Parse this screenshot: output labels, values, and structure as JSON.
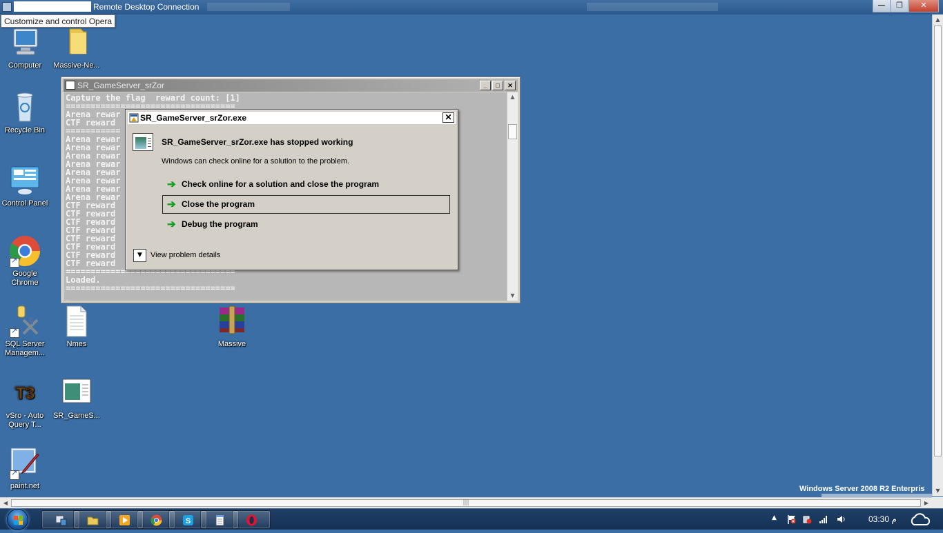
{
  "rdc": {
    "title": "Remote Desktop Connection",
    "tooltip": "Customize and control Opera"
  },
  "desktop": {
    "icons": [
      {
        "label": "Computer"
      },
      {
        "label": "Massive-Ne..."
      },
      {
        "label": "Recycle Bin"
      },
      {
        "label": "Control Panel"
      },
      {
        "label": "Google Chrome"
      },
      {
        "label": "SQL Server Managem..."
      },
      {
        "label": "Nmes"
      },
      {
        "label": "Massive"
      },
      {
        "label": "vSro - Auto Query T..."
      },
      {
        "label": "SR_GameS..."
      },
      {
        "label": "paint.net"
      }
    ],
    "watermark": "Windows Server 2008 R2 Enterpris"
  },
  "console": {
    "title": "SR_GameServer_srZor",
    "lines": [
      "Capture the flag  reward count: [1]",
      "==================================",
      "Arena rewar",
      "CTF reward",
      "===========",
      "Arena rewar",
      "Arena rewar",
      "Arena rewar",
      "Arena rewar",
      "Arena rewar",
      "Arena rewar",
      "Arena rewar",
      "Arena rewar",
      "CTF reward",
      "CTF reward",
      "CTF reward",
      "CTF reward",
      "CTF reward",
      "CTF reward",
      "CTF reward",
      "CTF reward",
      "==================================",
      "Loaded.",
      "==================================",
      "_"
    ]
  },
  "dialog": {
    "title": "SR_GameServer_srZor.exe",
    "heading": "SR_GameServer_srZor.exe has stopped working",
    "subtext": "Windows can check online for a solution to the problem.",
    "options": [
      {
        "label": "Check online for a solution and close the program",
        "selected": false
      },
      {
        "label": "Close the program",
        "selected": true
      },
      {
        "label": "Debug the program",
        "selected": false
      }
    ],
    "details_label": "View problem details"
  },
  "taskbar": {
    "clock": "03:30 م"
  },
  "colors": {
    "desktop": "#3a6ea5",
    "taskbar": "#1a375c",
    "console_bg": "#b7b7b7",
    "dialog_bg": "#d4d0c8",
    "option_arrow": "#10a020"
  }
}
